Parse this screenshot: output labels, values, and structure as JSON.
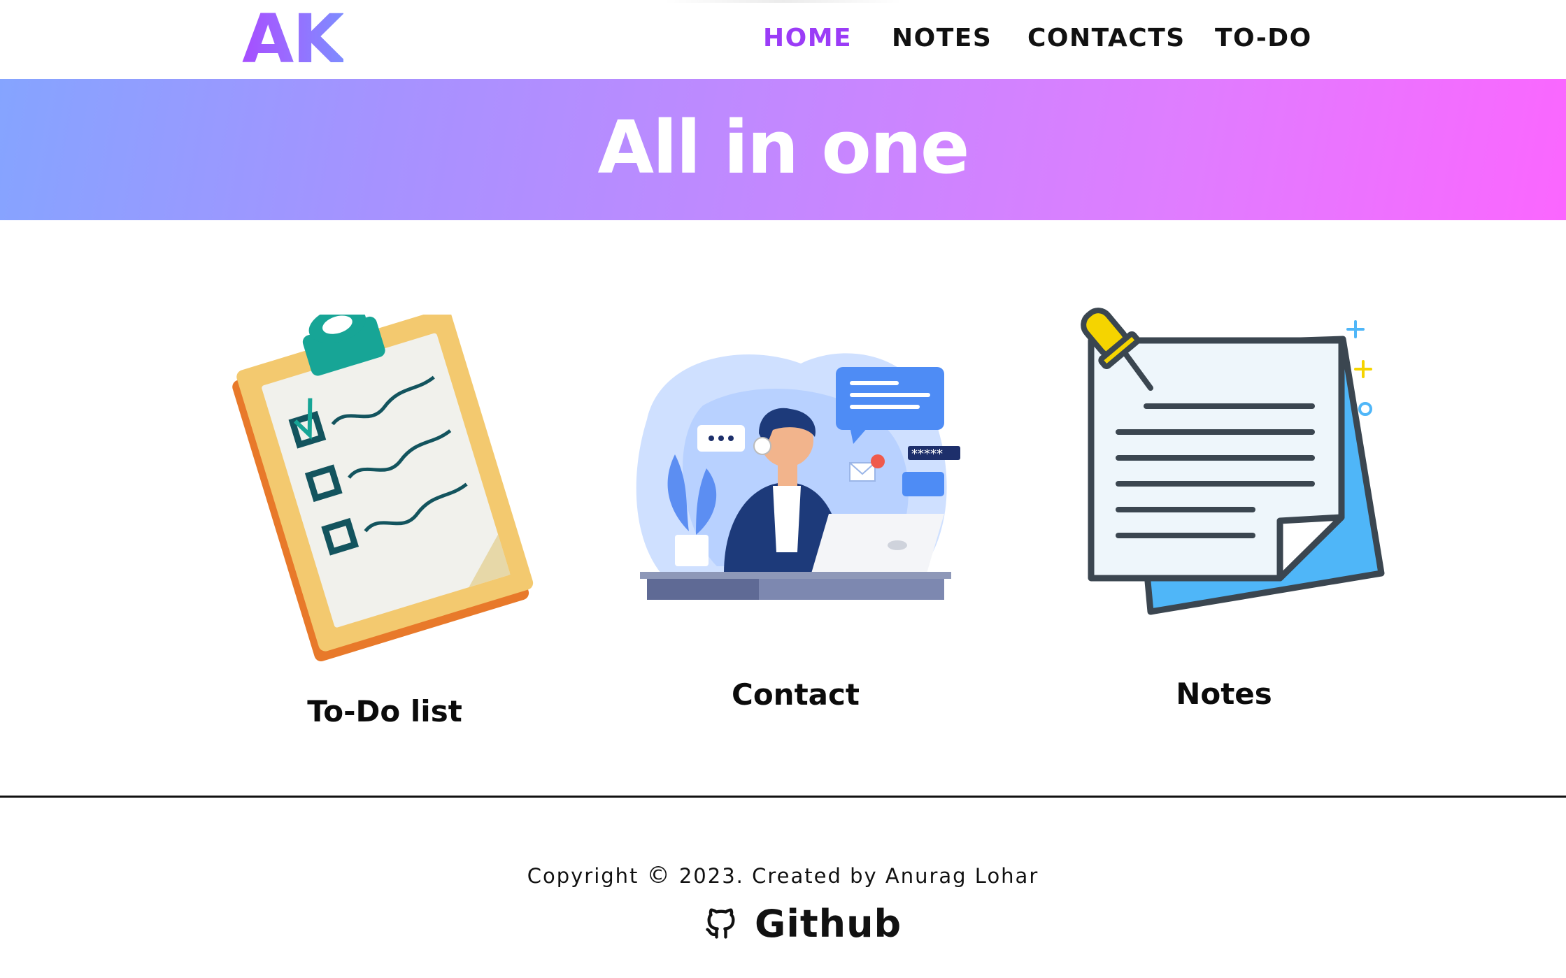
{
  "header": {
    "logo": "AK",
    "nav": [
      {
        "label": "HOME",
        "active": true
      },
      {
        "label": "NOTES",
        "active": false
      },
      {
        "label": "CONTACTS",
        "active": false
      },
      {
        "label": "TO-DO",
        "active": false
      }
    ],
    "active_color": "#9b3cf7"
  },
  "banner": {
    "title": "All in one",
    "gradient": [
      "#85a4ff",
      "#c388ff",
      "#fb66ff"
    ]
  },
  "cards": [
    {
      "label": "To-Do list",
      "icon": "clipboard-checklist-icon"
    },
    {
      "label": "Contact",
      "icon": "customer-support-illustration"
    },
    {
      "label": "Notes",
      "icon": "pinned-note-icon"
    }
  ],
  "footer": {
    "copyright_prefix": "Copyright",
    "copyright_symbol": "©",
    "copyright_suffix": "2023. Created by Anurag Lohar",
    "link_label": "Github",
    "link_icon": "github-icon"
  }
}
